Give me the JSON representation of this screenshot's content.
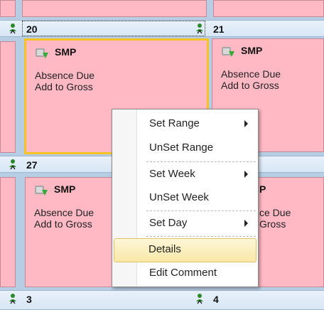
{
  "days": [
    {
      "num": "20",
      "code": "SMP",
      "line1": "Absence Due",
      "line2": "Add to Gross"
    },
    {
      "num": "21",
      "code": "SMP",
      "line1": "Absence Due",
      "line2": "Add to Gross"
    },
    {
      "num": "27",
      "code": "SMP",
      "line1": "Absence Due",
      "line2": "Add to Gross"
    },
    {
      "num": "",
      "code": "P",
      "line1": "ce Due",
      "line2": "Gross"
    },
    {
      "num": "3"
    },
    {
      "num": "4"
    }
  ],
  "context_menu": {
    "items": [
      {
        "label": "Set Range",
        "submenu": true
      },
      {
        "label": "UnSet Range",
        "submenu": false
      },
      {
        "label": "Set Week",
        "submenu": true
      },
      {
        "label": "UnSet Week",
        "submenu": false
      },
      {
        "label": "Set Day",
        "submenu": true
      },
      {
        "label": "Details",
        "submenu": false,
        "highlighted": true
      },
      {
        "label": "Edit Comment",
        "submenu": false
      }
    ]
  },
  "colors": {
    "block_fill": "#ffb9c4",
    "selected_border": "#f2c321",
    "header_fill": "#dde9f6",
    "menu_highlight": "#f9e8a7"
  },
  "icons": [
    "person-icon",
    "smp-icon",
    "submenu-arrow-icon"
  ]
}
